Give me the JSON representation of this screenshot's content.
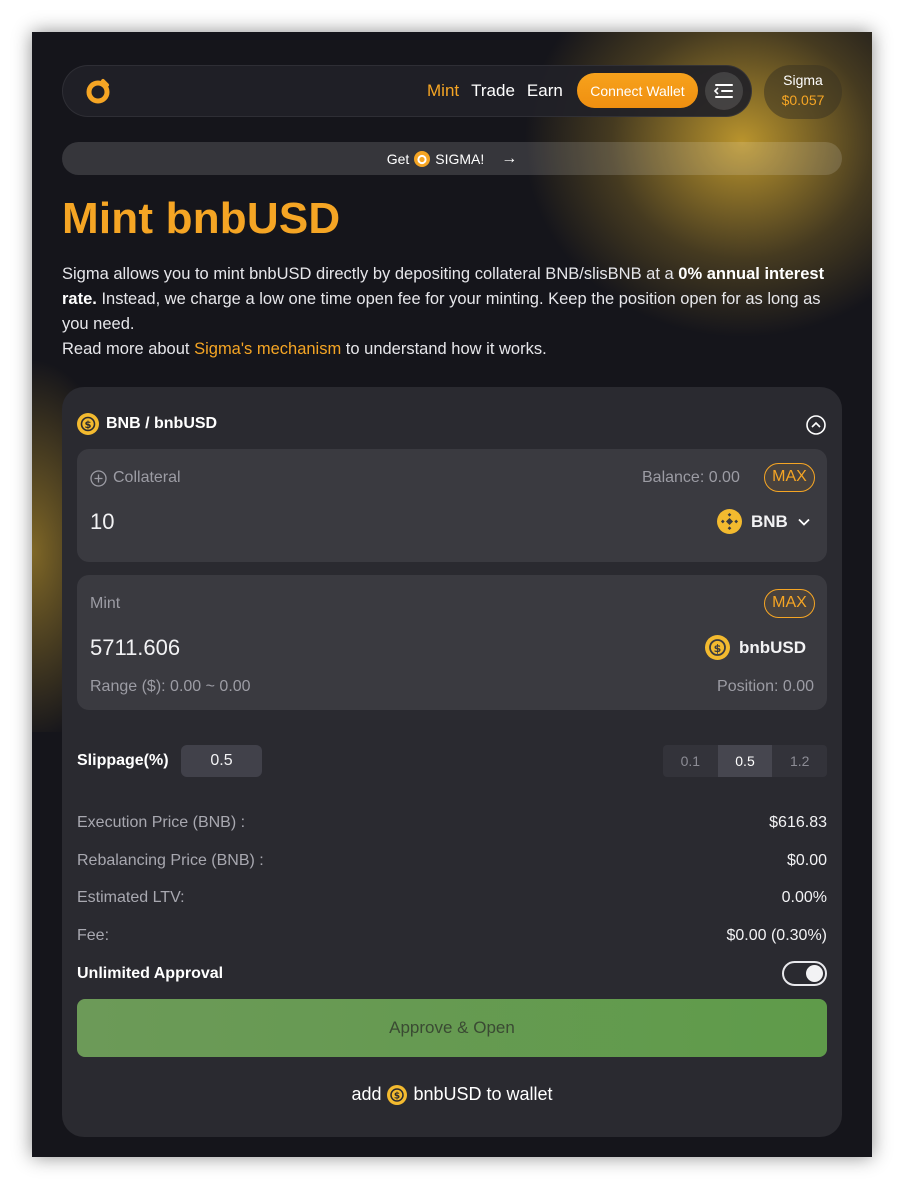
{
  "header": {
    "nav": [
      {
        "label": "Mint",
        "active": true
      },
      {
        "label": "Trade",
        "active": false
      },
      {
        "label": "Earn",
        "active": false
      }
    ],
    "connect_label": "Connect Wallet",
    "menu_icon": "menu-icon",
    "token_name": "Sigma",
    "token_price": "$0.057"
  },
  "banner": {
    "prefix": "Get",
    "token": "SIGMA!",
    "arrow": "→"
  },
  "page": {
    "title": "Mint bnbUSD",
    "desc_1": "Sigma allows you to mint bnbUSD directly by depositing collateral BNB/slisBNB at a ",
    "desc_bold": "0% annual interest rate.",
    "desc_2": " Instead, we charge a low one time open fee for your minting. Keep the position open for as long as you need.",
    "desc_3": "Read more about ",
    "desc_link": "Sigma's mechanism",
    "desc_4": " to understand how it works."
  },
  "card": {
    "pair": "BNB / bnbUSD",
    "collateral": {
      "label": "Collateral",
      "balance": "Balance: 0.00",
      "max": "MAX",
      "value": "10",
      "token": "BNB"
    },
    "mint": {
      "label": "Mint",
      "max": "MAX",
      "value": "5711.606",
      "token": "bnbUSD",
      "range": "Range ($): 0.00 ~ 0.00",
      "position": "Position: 0.00"
    },
    "slippage": {
      "label": "Slippage(%)",
      "value": "0.5",
      "options": [
        "0.1",
        "0.5",
        "1.2"
      ],
      "selected": "0.5"
    },
    "info": [
      {
        "key": "Execution Price (BNB) :",
        "value": "$616.83"
      },
      {
        "key": "Rebalancing Price (BNB) :",
        "value": "$0.00"
      },
      {
        "key": "Estimated LTV:",
        "value": "0.00%"
      },
      {
        "key": "Fee:",
        "value": "$0.00 (0.30%)"
      }
    ],
    "unlimited_label": "Unlimited Approval",
    "unlimited_on": true,
    "approve_label": "Approve & Open",
    "add_wallet_1": "add",
    "add_wallet_2": "bnbUSD to wallet"
  },
  "colors": {
    "accent": "#f5a524",
    "approve_green": "#5f9b4a",
    "background": "#15151b",
    "card": "#2a2a30"
  }
}
